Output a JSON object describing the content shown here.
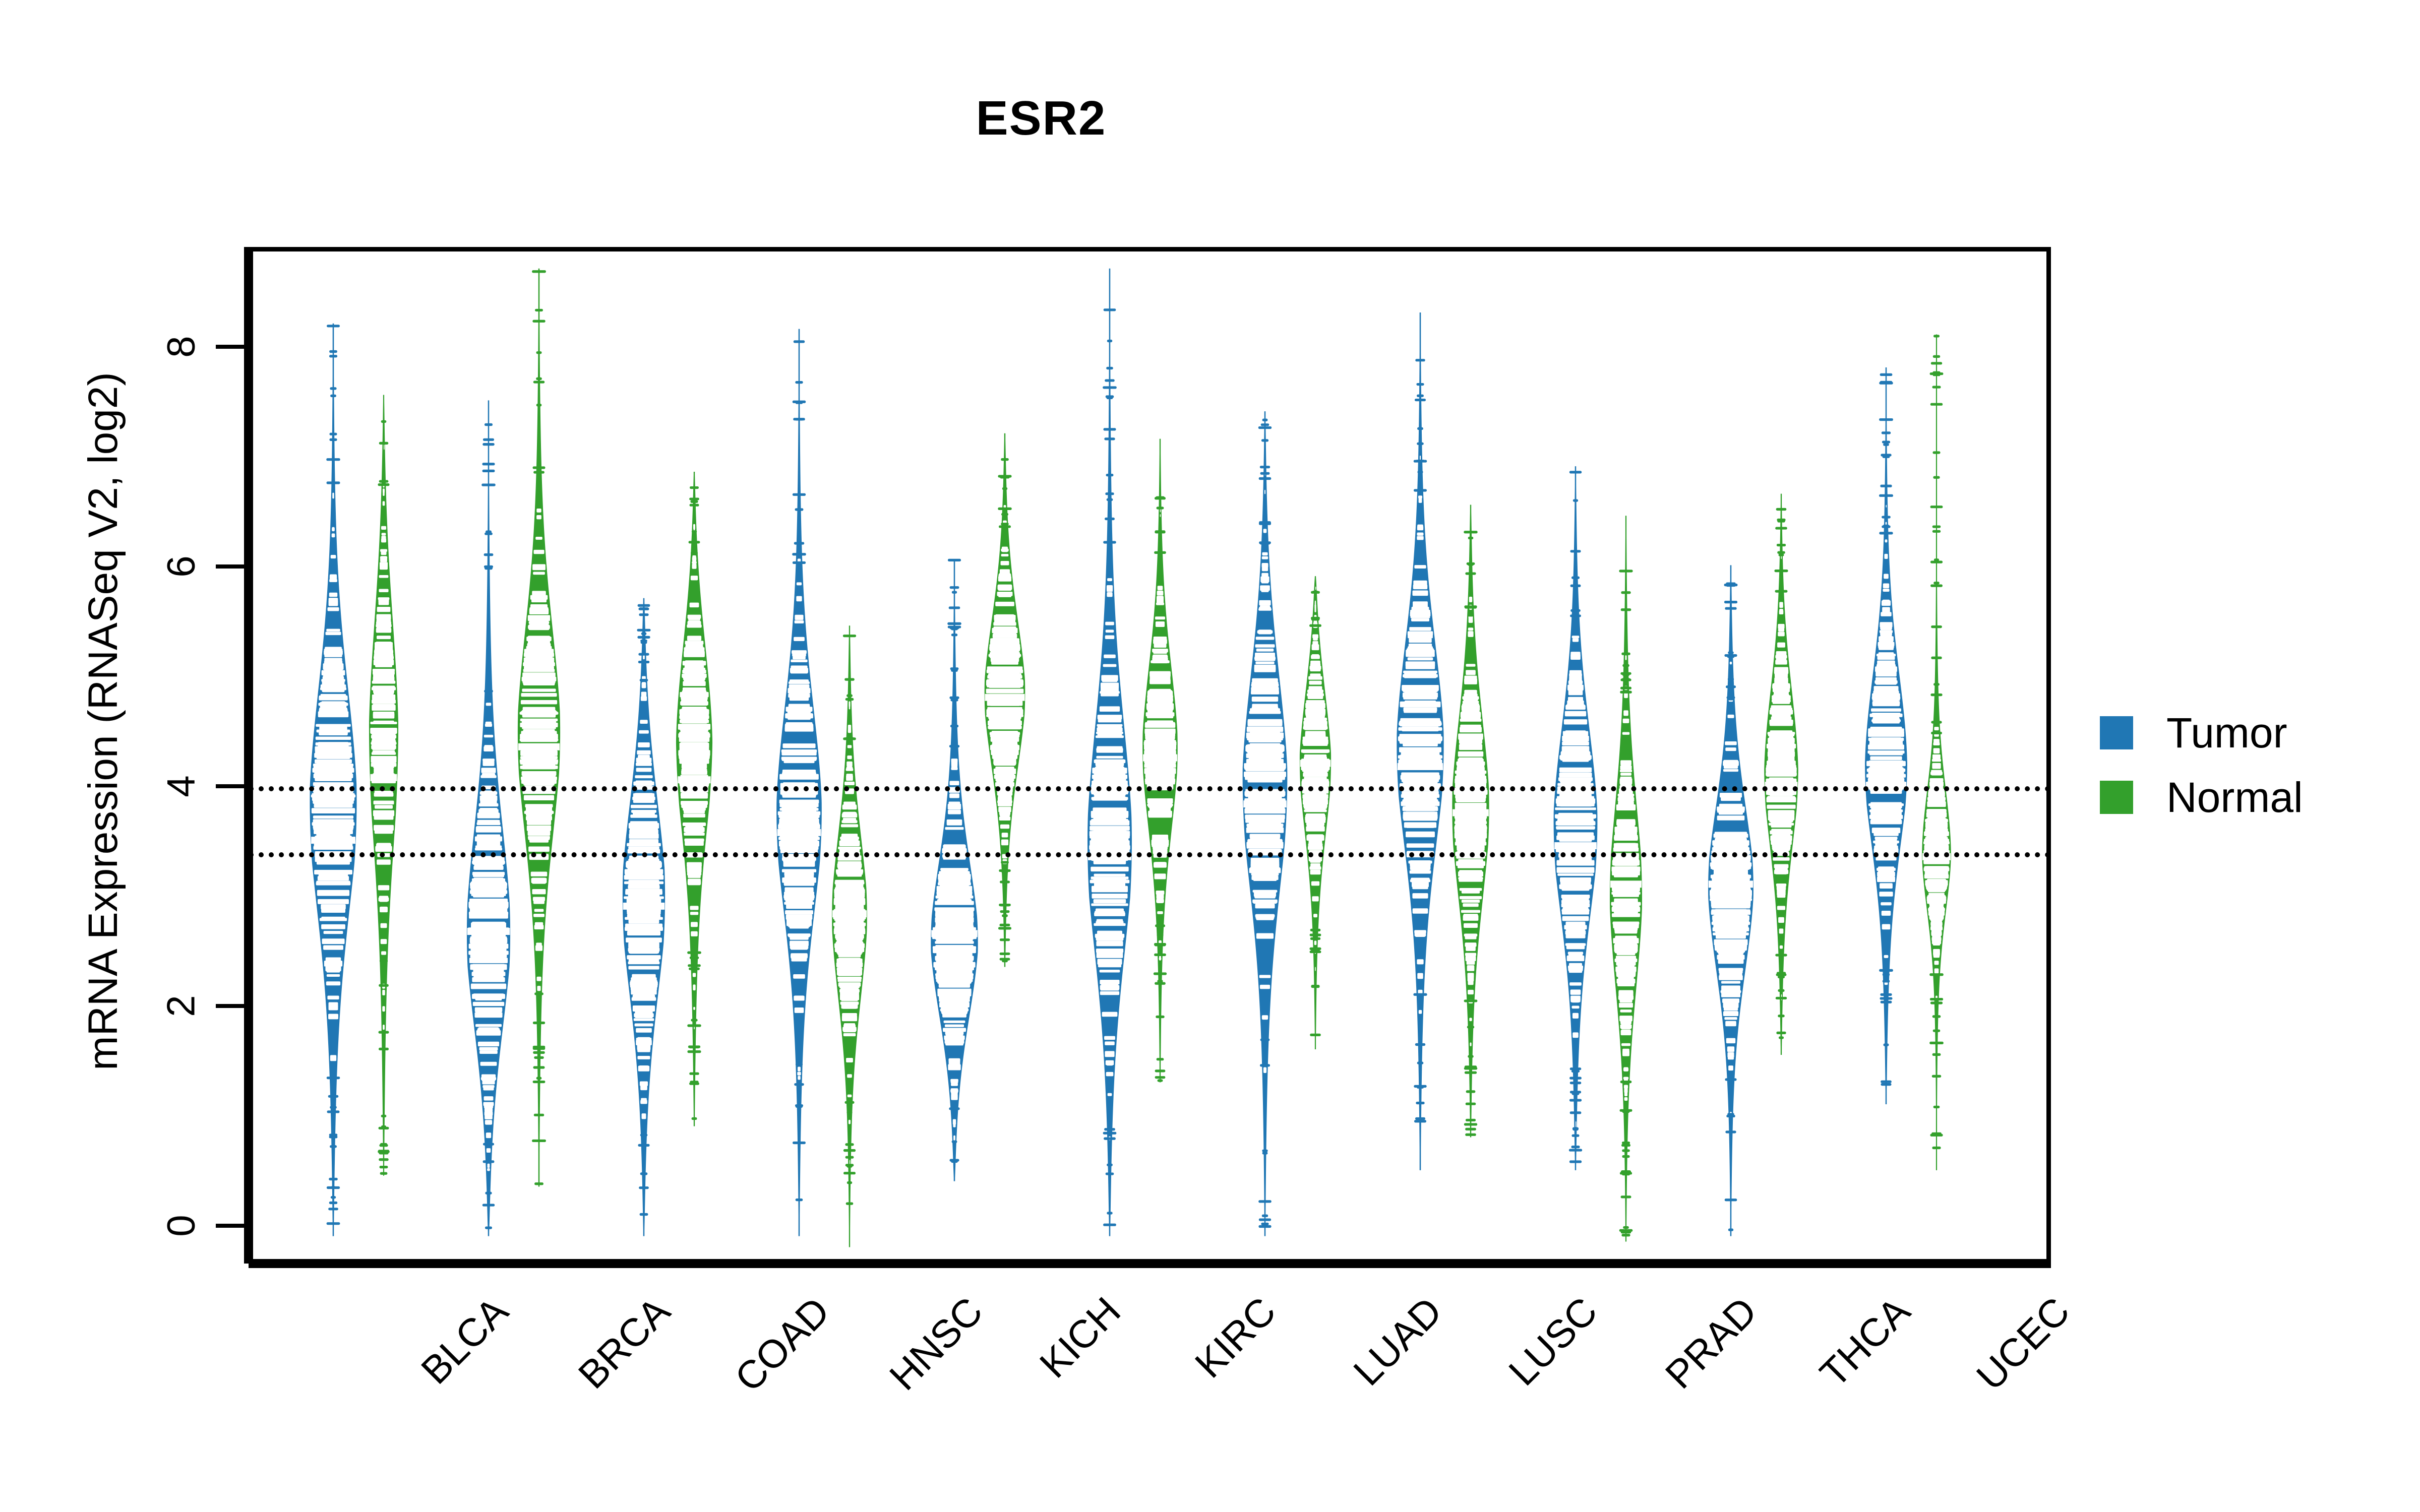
{
  "chart_data": {
    "type": "violin",
    "title": "ESR2",
    "xlabel": "",
    "ylabel": "mRNA Expression (RNASeq V2, log2)",
    "ylim": [
      -0.55,
      9.0
    ],
    "yticks": [
      0,
      2,
      4,
      6,
      8
    ],
    "ytick_labels": [
      "0",
      "2",
      "4",
      "6",
      "8"
    ],
    "grid": false,
    "legend_position": "right",
    "reference_lines": [
      4.0,
      3.4
    ],
    "categories": [
      "BLCA",
      "BRCA",
      "COAD",
      "HNSC",
      "KICH",
      "KIRC",
      "LUAD",
      "LUSC",
      "PRAD",
      "THCA",
      "UCEC"
    ],
    "series": [
      {
        "name": "Tumor",
        "color": "#2077b4",
        "stats": [
          {
            "category": "BLCA",
            "median": 3.55,
            "q1": 2.85,
            "q3": 4.6,
            "min": -0.05,
            "max": 8.25,
            "peak": 3.95,
            "width": 1.0
          },
          {
            "category": "BRCA",
            "median": 2.72,
            "q1": 1.95,
            "q3": 3.55,
            "min": -0.05,
            "max": 7.55,
            "peak": 2.7,
            "width": 0.92
          },
          {
            "category": "COAD",
            "median": 2.95,
            "q1": 2.15,
            "q3": 3.75,
            "min": -0.05,
            "max": 5.75,
            "peak": 3.05,
            "width": 0.9
          },
          {
            "category": "HNSC",
            "median": 3.62,
            "q1": 2.85,
            "q3": 4.45,
            "min": -0.05,
            "max": 8.2,
            "peak": 3.85,
            "width": 0.96
          },
          {
            "category": "KICH",
            "median": 2.7,
            "q1": 2.1,
            "q3": 3.35,
            "min": 0.45,
            "max": 6.1,
            "peak": 2.6,
            "width": 1.0
          },
          {
            "category": "KIRC",
            "median": 3.4,
            "q1": 2.55,
            "q3": 4.35,
            "min": -0.05,
            "max": 8.75,
            "peak": 3.55,
            "width": 0.94
          },
          {
            "category": "LUAD",
            "median": 3.88,
            "q1": 3.0,
            "q3": 4.7,
            "min": -0.05,
            "max": 7.45,
            "peak": 4.15,
            "width": 0.95
          },
          {
            "category": "LUSC",
            "median": 4.22,
            "q1": 3.45,
            "q3": 5.05,
            "min": 0.55,
            "max": 8.35,
            "peak": 4.45,
            "width": 1.0
          },
          {
            "category": "PRAD",
            "median": 3.5,
            "q1": 2.8,
            "q3": 4.3,
            "min": 0.55,
            "max": 6.95,
            "peak": 3.75,
            "width": 0.93
          },
          {
            "category": "THCA",
            "median": 3.15,
            "q1": 2.55,
            "q3": 3.85,
            "min": -0.05,
            "max": 6.05,
            "peak": 3.1,
            "width": 0.96
          },
          {
            "category": "UCEC",
            "median": 4.05,
            "q1": 3.4,
            "q3": 4.75,
            "min": 1.15,
            "max": 7.85,
            "peak": 4.3,
            "width": 0.9
          }
        ]
      },
      {
        "name": "Normal",
        "color": "#33a02c",
        "stats": [
          {
            "category": "BLCA",
            "median": 4.12,
            "q1": 3.3,
            "q3": 5.1,
            "min": 0.5,
            "max": 7.6,
            "peak": 4.65,
            "width": 0.62
          },
          {
            "category": "BRCA",
            "median": 4.4,
            "q1": 3.65,
            "q3": 5.25,
            "min": 0.4,
            "max": 8.75,
            "peak": 4.55,
            "width": 0.9
          },
          {
            "category": "COAD",
            "median": 4.1,
            "q1": 3.4,
            "q3": 4.9,
            "min": 0.95,
            "max": 6.9,
            "peak": 4.6,
            "width": 0.78
          },
          {
            "category": "HNSC",
            "median": 2.88,
            "q1": 2.25,
            "q3": 3.55,
            "min": -0.15,
            "max": 5.5,
            "peak": 2.85,
            "width": 0.74
          },
          {
            "category": "KICH",
            "median": 4.85,
            "q1": 4.25,
            "q3": 5.45,
            "min": 2.4,
            "max": 7.25,
            "peak": 4.9,
            "width": 0.86
          },
          {
            "category": "KIRC",
            "median": 4.3,
            "q1": 3.7,
            "q3": 5.0,
            "min": 1.35,
            "max": 7.2,
            "peak": 4.4,
            "width": 0.74
          },
          {
            "category": "LUAD",
            "median": 4.25,
            "q1": 3.55,
            "q3": 4.75,
            "min": 1.65,
            "max": 5.95,
            "peak": 4.3,
            "width": 0.66
          },
          {
            "category": "LUSC",
            "median": 3.8,
            "q1": 3.05,
            "q3": 4.5,
            "min": 0.85,
            "max": 6.6,
            "peak": 3.85,
            "width": 0.78
          },
          {
            "category": "PRAD",
            "median": 3.15,
            "q1": 2.45,
            "q3": 3.9,
            "min": -0.1,
            "max": 6.5,
            "peak": 3.0,
            "width": 0.68
          },
          {
            "category": "THCA",
            "median": 4.05,
            "q1": 3.4,
            "q3": 4.65,
            "min": 1.6,
            "max": 6.7,
            "peak": 4.25,
            "width": 0.72
          },
          {
            "category": "UCEC",
            "median": 3.4,
            "q1": 2.95,
            "q3": 3.85,
            "min": 0.55,
            "max": 8.15,
            "peak": 3.45,
            "width": 0.62
          }
        ]
      }
    ]
  },
  "legend": {
    "items": [
      {
        "label": "Tumor",
        "color": "#2077b4"
      },
      {
        "label": "Normal",
        "color": "#33a02c"
      }
    ]
  }
}
